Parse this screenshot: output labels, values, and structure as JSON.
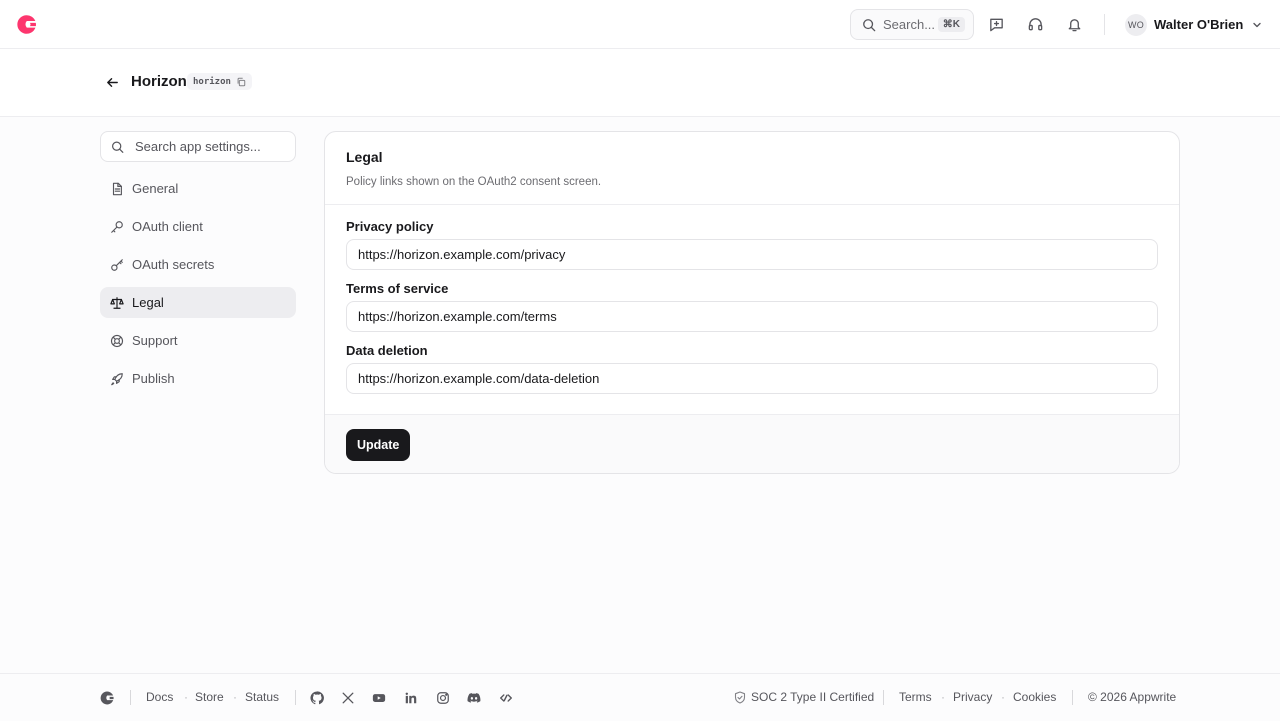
{
  "topbar": {
    "search_label": "Search...",
    "search_shortcut": "⌘K",
    "user_initials": "WO",
    "user_name": "Walter O'Brien"
  },
  "header": {
    "title": "Horizon",
    "app_id": "horizon"
  },
  "sidebar": {
    "search_placeholder": "Search app settings...",
    "items": [
      {
        "label": "General",
        "icon": "document-icon"
      },
      {
        "label": "OAuth client",
        "icon": "key-icon"
      },
      {
        "label": "OAuth secrets",
        "icon": "secret-key-icon"
      },
      {
        "label": "Legal",
        "icon": "scale-icon",
        "active": true
      },
      {
        "label": "Support",
        "icon": "lifebuoy-icon"
      },
      {
        "label": "Publish",
        "icon": "rocket-icon"
      }
    ]
  },
  "card": {
    "title": "Legal",
    "subtitle": "Policy links shown on the OAuth2 consent screen.",
    "fields": [
      {
        "label": "Privacy policy",
        "value": "https://horizon.example.com/privacy"
      },
      {
        "label": "Terms of service",
        "value": "https://horizon.example.com/terms"
      },
      {
        "label": "Data deletion",
        "value": "https://horizon.example.com/data-deletion"
      }
    ],
    "submit_label": "Update"
  },
  "footer": {
    "links": [
      "Docs",
      "Store",
      "Status"
    ],
    "socials": [
      "github-icon",
      "x-icon",
      "youtube-icon",
      "linkedin-icon",
      "instagram-icon",
      "discord-icon",
      "daily-dev-icon"
    ],
    "certification": "SOC 2 Type II Certified",
    "legal_links": [
      "Terms",
      "Privacy",
      "Cookies"
    ],
    "copyright": "© 2026 Appwrite"
  },
  "colors": {
    "brand": "#fd366e",
    "text_primary": "#19191c",
    "text_secondary": "#56565c",
    "button_bg": "#19191c",
    "border": "#e4e4e7"
  }
}
